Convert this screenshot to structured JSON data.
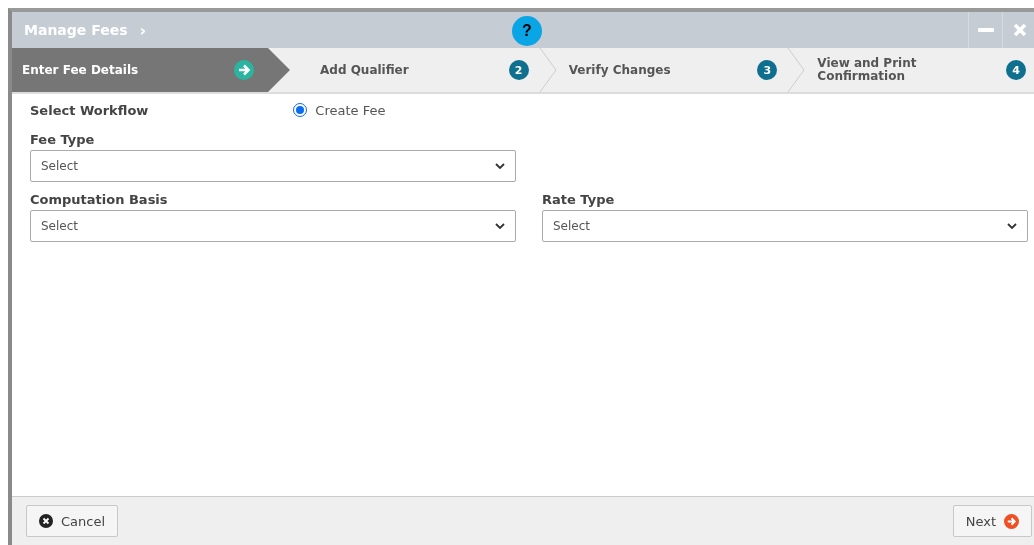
{
  "dialog": {
    "title": "Manage Fees",
    "title_chevron": "›",
    "help": "?"
  },
  "steps": [
    {
      "label": "Enter Fee Details",
      "selected": true
    },
    {
      "label": "Add Qualifier",
      "number": "2",
      "selected": false
    },
    {
      "label": "Verify Changes",
      "number": "3",
      "selected": false
    },
    {
      "label": "View and Print Confirmation",
      "number": "4",
      "selected": false
    }
  ],
  "workflow": {
    "label": "Select Workflow",
    "option": "Create Fee",
    "selected": true
  },
  "fields": [
    {
      "label": "Fee Type",
      "placeholder": "Select"
    },
    {
      "label": "Computation Basis",
      "placeholder": "Select"
    },
    {
      "label": "Rate Type",
      "placeholder": "Select"
    }
  ],
  "footer": {
    "cancel": "Cancel",
    "next": "Next"
  }
}
